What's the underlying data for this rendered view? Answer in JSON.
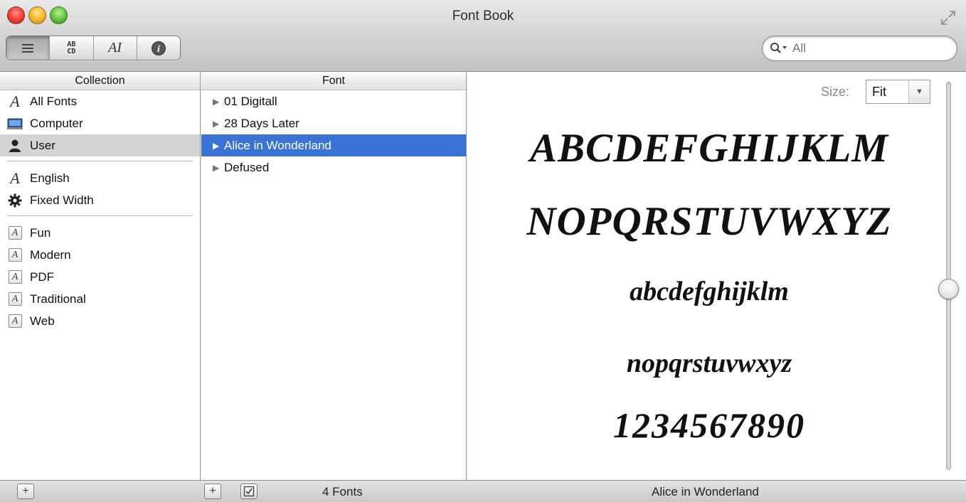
{
  "window": {
    "title": "Font Book"
  },
  "toolbar": {
    "view_buttons": [
      {
        "name": "list-view",
        "icon": "list-icon"
      },
      {
        "name": "sample-view",
        "icon": "abcd-icon",
        "label_top": "AB",
        "label_bottom": "CD"
      },
      {
        "name": "custom-view",
        "icon": "text-cursor-icon",
        "label": "AI"
      },
      {
        "name": "info-view",
        "icon": "info-icon"
      }
    ],
    "search": {
      "scope": "All",
      "value": ""
    }
  },
  "collection": {
    "header": "Collection",
    "items": [
      {
        "label": "All Fonts",
        "icon": "script-a-icon"
      },
      {
        "label": "Computer",
        "icon": "computer-icon"
      },
      {
        "label": "User",
        "icon": "user-icon",
        "selected": true
      }
    ],
    "smart": [
      {
        "label": "English",
        "icon": "script-a-icon"
      },
      {
        "label": "Fixed Width",
        "icon": "gear-icon"
      }
    ],
    "user_collections": [
      {
        "label": "Fun",
        "icon": "boxed-a-icon"
      },
      {
        "label": "Modern",
        "icon": "boxed-a-icon"
      },
      {
        "label": "PDF",
        "icon": "boxed-a-icon"
      },
      {
        "label": "Traditional",
        "icon": "boxed-a-icon"
      },
      {
        "label": "Web",
        "icon": "boxed-a-icon"
      }
    ]
  },
  "fonts": {
    "header": "Font",
    "items": [
      {
        "label": "01 Digitall"
      },
      {
        "label": "28 Days Later"
      },
      {
        "label": "Alice in Wonderland",
        "selected": true
      },
      {
        "label": "Defused"
      }
    ]
  },
  "preview": {
    "size_label": "Size:",
    "size_value": "Fit",
    "lines": [
      "ABCDEFGHIJKLM",
      "NOPQRSTUVWXYZ",
      "abcdefghijklm",
      "nopqrstuvwxyz",
      "1234567890"
    ],
    "selection_color": "#3a73d6"
  },
  "statusbar": {
    "font_count": "4 Fonts",
    "selected_font": "Alice in Wonderland"
  }
}
